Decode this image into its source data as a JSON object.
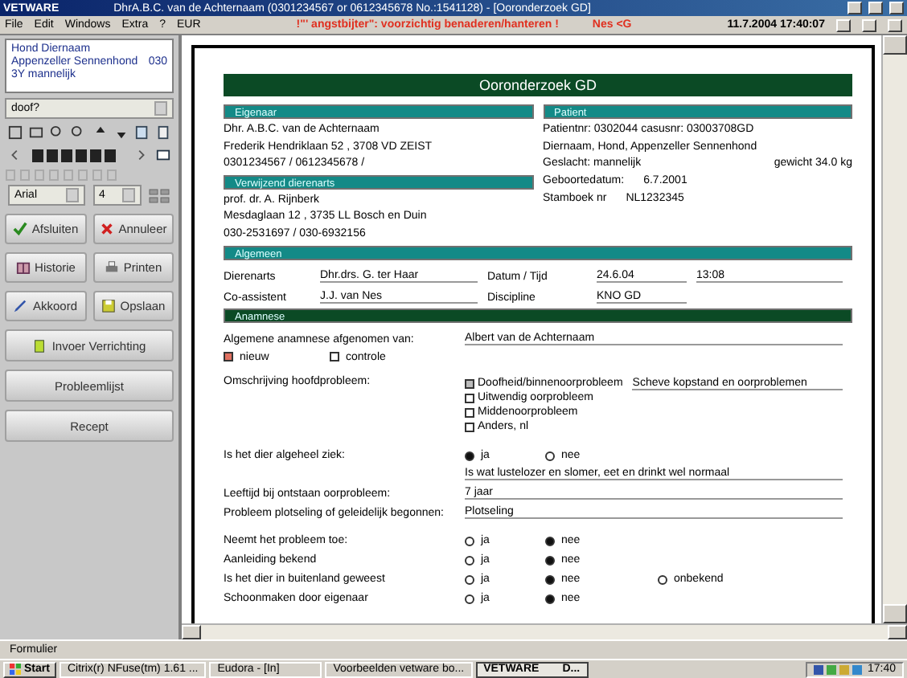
{
  "window": {
    "app": "VETWARE",
    "title": "DhrA.B.C. van de Achternaam (0301234567 or 0612345678 No.:1541128)  - [Ooronderzoek GD]"
  },
  "menu": {
    "items": [
      "File",
      "Edit",
      "Windows",
      "Extra",
      "?",
      "EUR"
    ],
    "warning": "!\"' angstbijter\": voorzichtig benaderen/hanteren !",
    "user": "Nes <G",
    "datetime": "11.7.2004 17:40:07"
  },
  "sidebar": {
    "patient": [
      [
        "Hond Diernaam"
      ],
      [
        "Appenzeller Sennenhond",
        "030"
      ],
      [
        "3Y mannelijk"
      ]
    ],
    "search": "doof?",
    "font": "Arial",
    "font_size": "4",
    "buttons": [
      {
        "label": "Afsluiten",
        "kind": "check"
      },
      {
        "label": "Annuleer",
        "kind": "cross"
      },
      {
        "label": "Historie",
        "kind": "book"
      },
      {
        "label": "Printen",
        "kind": "printer"
      },
      {
        "label": "Akkoord",
        "kind": "pen"
      },
      {
        "label": "Opslaan",
        "kind": "save"
      }
    ],
    "wide_buttons": [
      {
        "label": "Invoer Verrichting",
        "kind": "note"
      },
      {
        "label": "Probleemlijst",
        "kind": "plain"
      },
      {
        "label": "Recept",
        "kind": "plain"
      }
    ]
  },
  "document": {
    "title": "Ooronderzoek GD",
    "owner": {
      "heading": "Eigenaar",
      "lines": [
        "Dhr. A.B.C. van de Achternaam",
        "Frederik Hendriklaan 52 , 3708 VD  ZEIST",
        "0301234567 / 0612345678 /"
      ]
    },
    "referrer": {
      "heading": "Verwijzend dierenarts",
      "lines": [
        "prof. dr. A. Rijnberk",
        "Mesdaglaan 12   ,   3735 LL Bosch en Duin",
        "030-2531697 / 030-6932156"
      ]
    },
    "patient": {
      "heading": "Patient",
      "lines": [
        "Patientnr: 0302044    casusnr: 03003708GD",
        "Diernaam, Hond, Appenzeller Sennenhond"
      ],
      "sex": "Geslacht: mannelijk",
      "weight": "gewicht  34.0 kg",
      "facts": [
        [
          "Geboortedatum:",
          "6.7.2001"
        ],
        [
          "Stamboek nr",
          "NL1232345"
        ]
      ]
    },
    "general": {
      "heading": "Algemeen",
      "rows": [
        [
          "Dierenarts",
          "Dhr.drs. G. ter Haar",
          "Datum / Tijd",
          "24.6.04",
          "13:08"
        ],
        [
          "Co-assistent",
          "J.J. van Nes",
          "Discipline",
          "KNO GD"
        ]
      ]
    },
    "anamnesis": {
      "heading": "Anamnese",
      "taken_label": "Algemene anamnese afgenomen van:",
      "taken_value": "Albert van de Achternaam",
      "visit": [
        {
          "label": "nieuw",
          "checked": true
        },
        {
          "label": "controle",
          "checked": false
        }
      ],
      "problem_label": "Omschrijving hoofdprobleem:",
      "problems": [
        {
          "label": "Doofheid/binnenoorprobleem",
          "checked": true
        },
        {
          "label": "Uitwendig oorprobleem",
          "checked": false
        },
        {
          "label": "Middenoorprobleem",
          "checked": false
        },
        {
          "label": "Anders, nl",
          "checked": false
        }
      ],
      "problem_text": "Scheve kopstand en oorproblemen",
      "ill": {
        "label": "Is het dier algeheel ziek:",
        "options": [
          {
            "label": "ja",
            "selected": true
          },
          {
            "label": "nee",
            "selected": false
          }
        ],
        "answer": "Is wat lustelozer en slomer, eet en drinkt wel normaal"
      },
      "fields": [
        [
          "Leeftijd bij ontstaan oorprobleem:",
          "7 jaar"
        ],
        [
          "Probleem plotseling of geleidelijk begonnen:",
          "Plotseling"
        ]
      ],
      "questions": [
        {
          "label": "Neemt het probleem toe:",
          "options": [
            {
              "label": "ja",
              "selected": false
            },
            {
              "label": "nee",
              "selected": true
            }
          ]
        },
        {
          "label": "Aanleiding bekend",
          "options": [
            {
              "label": "ja",
              "selected": false
            },
            {
              "label": "nee",
              "selected": true
            }
          ]
        },
        {
          "label": "Is het dier in buitenland geweest",
          "options": [
            {
              "label": "ja",
              "selected": false
            },
            {
              "label": "nee",
              "selected": true
            },
            {
              "label": "onbekend",
              "selected": false
            }
          ]
        },
        {
          "label": "Schoonmaken door eigenaar",
          "options": [
            {
              "label": "ja",
              "selected": false
            },
            {
              "label": "nee",
              "selected": true
            }
          ]
        }
      ]
    }
  },
  "status_bar": "Formulier",
  "taskbar": {
    "start": "Start",
    "tasks": [
      {
        "label": "Citrix(r) NFuse(tm) 1.61 ...",
        "selected": false
      },
      {
        "label": "Eudora - [In]",
        "selected": false
      },
      {
        "label": "Voorbeelden vetware bo...",
        "selected": false
      },
      {
        "label": "VETWARE",
        "extra": "D...",
        "selected": true
      }
    ],
    "clock": "17:40"
  }
}
